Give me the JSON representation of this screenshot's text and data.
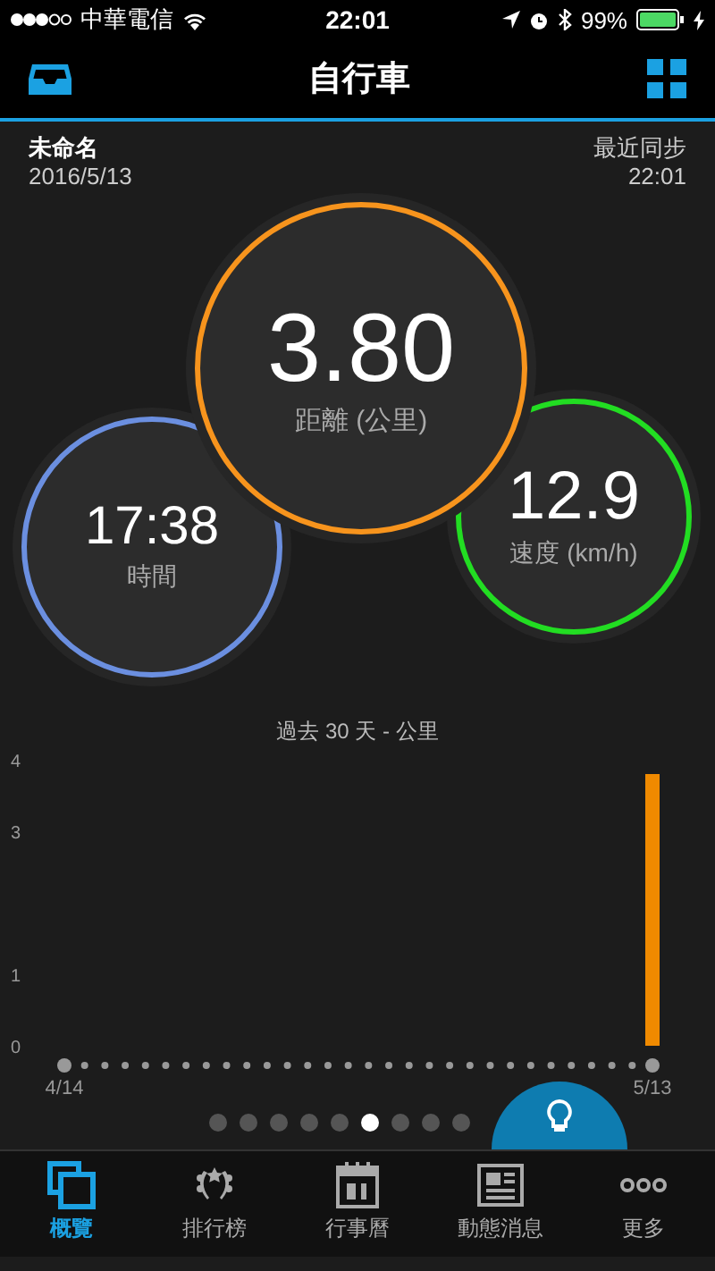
{
  "status_bar": {
    "carrier": "中華電信",
    "time": "22:01",
    "battery": "99%"
  },
  "nav_bar": {
    "title": "自行車"
  },
  "device": {
    "name": "未命名",
    "date": "2016/5/13",
    "sync_label": "最近同步",
    "sync_time": "22:01"
  },
  "metrics": [
    {
      "kind": "primary",
      "value": "3.80",
      "label": "距離 (公里)",
      "color": "#f7941d"
    },
    {
      "kind": "left",
      "value": "17:38",
      "label": "時間",
      "color": "#6b8fe0"
    },
    {
      "kind": "right",
      "value": "12.9",
      "label": "速度 (km/h)",
      "color": "#22dd22"
    }
  ],
  "chart_caption": "過去 30 天 - 公里",
  "chart_data": {
    "type": "bar",
    "categories": [
      "4/14",
      null,
      null,
      null,
      null,
      null,
      null,
      null,
      null,
      null,
      null,
      null,
      null,
      null,
      null,
      null,
      null,
      null,
      null,
      null,
      null,
      null,
      null,
      null,
      null,
      null,
      null,
      null,
      null,
      "5/13"
    ],
    "values": [
      0,
      0,
      0,
      0,
      0,
      0,
      0,
      0,
      0,
      0,
      0,
      0,
      0,
      0,
      0,
      0,
      0,
      0,
      0,
      0,
      0,
      0,
      0,
      0,
      0,
      0,
      0,
      0,
      0,
      3.8
    ],
    "ylim": [
      0,
      4
    ],
    "yticks": [
      0,
      1,
      3,
      4
    ]
  },
  "pages": [
    {
      "selected": false
    },
    {
      "selected": false
    },
    {
      "selected": false
    },
    {
      "selected": false
    },
    {
      "selected": false
    },
    {
      "selected": true
    },
    {
      "selected": false
    },
    {
      "selected": false
    },
    {
      "selected": false
    }
  ],
  "tabs": [
    {
      "kind": "overview",
      "label": "概覽",
      "selected": true
    },
    {
      "kind": "leaderboard",
      "label": "排行榜",
      "selected": false
    },
    {
      "kind": "calendar",
      "label": "行事曆",
      "selected": false
    },
    {
      "kind": "news",
      "label": "動態消息",
      "selected": false
    },
    {
      "kind": "more",
      "label": "更多",
      "selected": false
    }
  ]
}
